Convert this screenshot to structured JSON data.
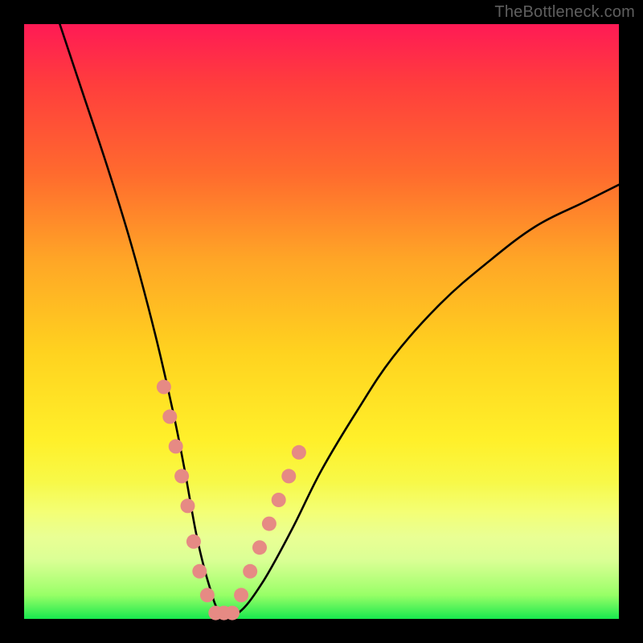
{
  "watermark": "TheBottleneck.com",
  "chart_data": {
    "type": "line",
    "title": "",
    "xlabel": "",
    "ylabel": "",
    "xlim": [
      0,
      100
    ],
    "ylim": [
      0,
      100
    ],
    "series": [
      {
        "name": "bottleneck-curve",
        "x": [
          6,
          10,
          14,
          18,
          22,
          25,
          27,
          29,
          31,
          33,
          36,
          40,
          45,
          50,
          56,
          62,
          70,
          78,
          86,
          94,
          100
        ],
        "values": [
          100,
          88,
          76,
          63,
          48,
          35,
          25,
          14,
          6,
          1,
          1,
          6,
          15,
          25,
          35,
          44,
          53,
          60,
          66,
          70,
          73
        ]
      }
    ],
    "markers": {
      "name": "highlight-dots",
      "color": "#e68a84",
      "x": [
        23.5,
        24.5,
        25.5,
        26.5,
        27.5,
        28.5,
        29.5,
        30.8,
        32.2,
        33.6,
        35.0,
        36.5,
        38.0,
        39.6,
        41.2,
        42.8,
        44.5,
        46.2
      ],
      "values": [
        39,
        34,
        29,
        24,
        19,
        13,
        8,
        4,
        1,
        1,
        1,
        4,
        8,
        12,
        16,
        20,
        24,
        28
      ]
    },
    "background_gradient": [
      "#ff1a55",
      "#ffd21f",
      "#17e84e"
    ]
  }
}
